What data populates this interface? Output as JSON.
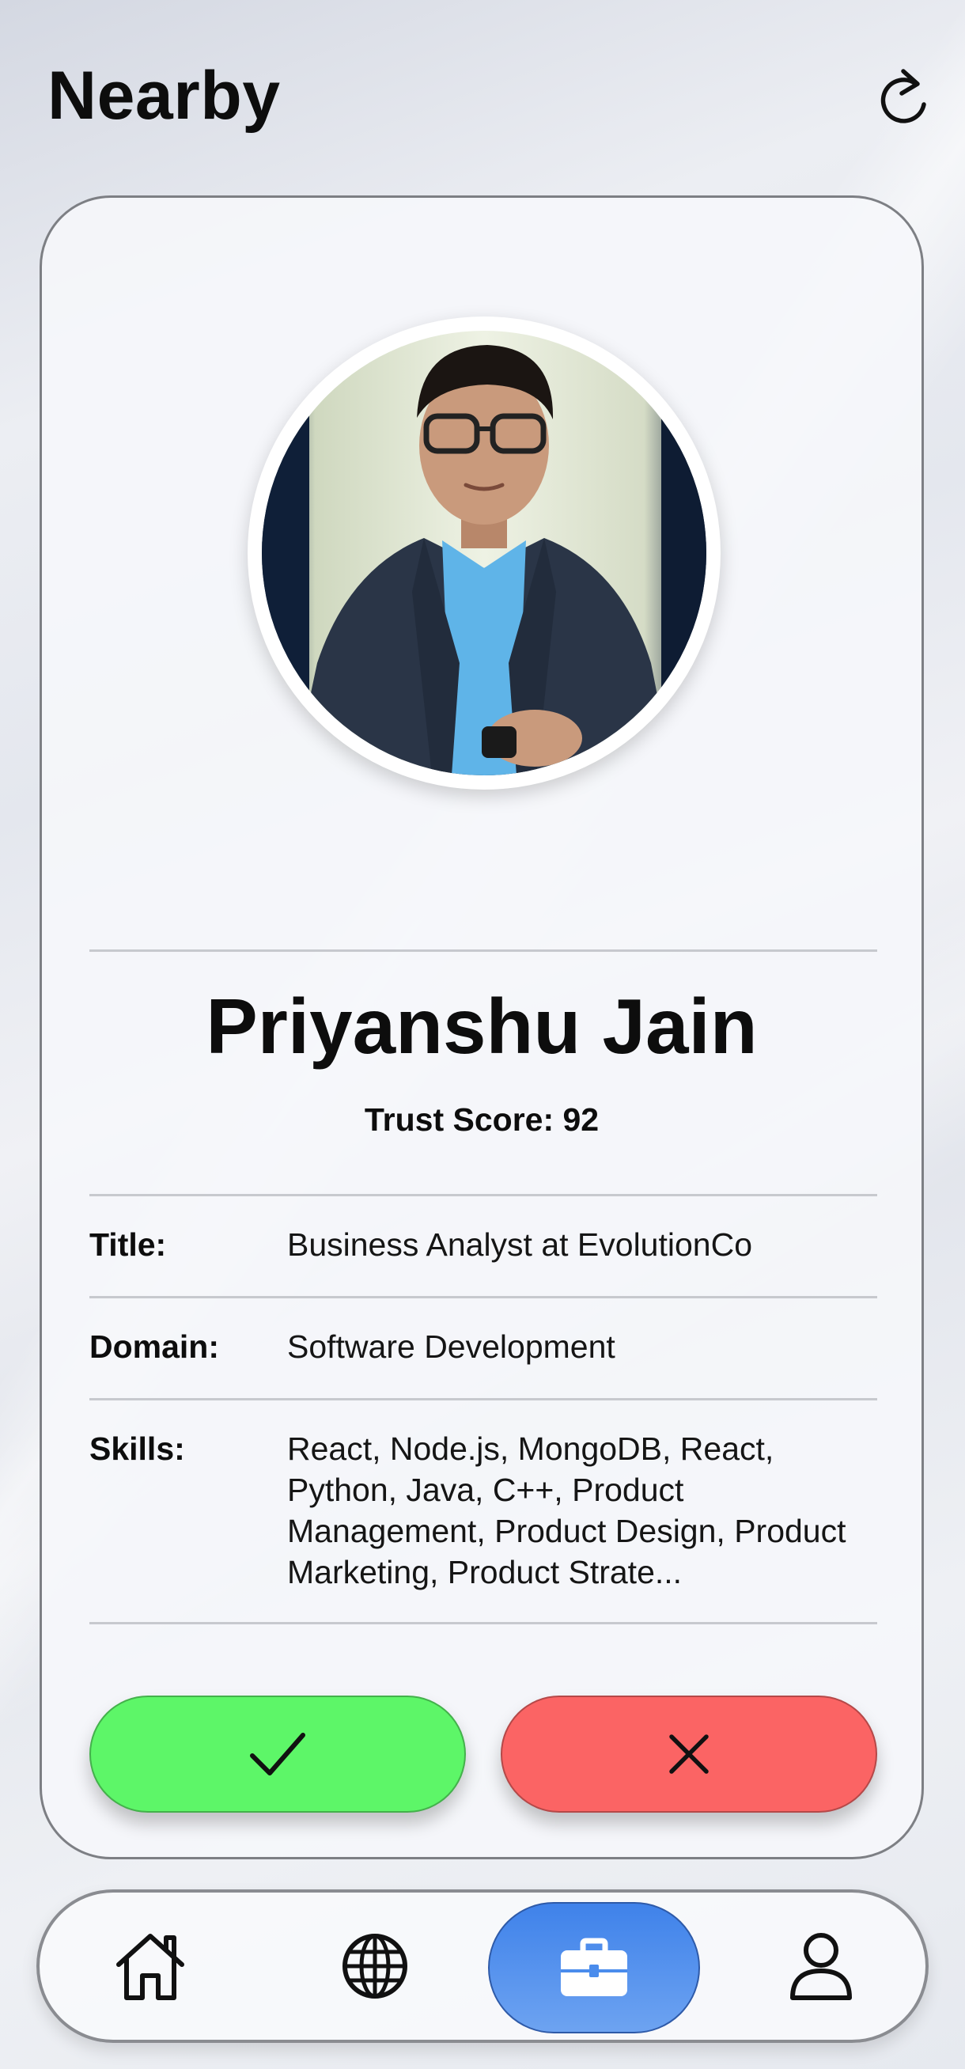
{
  "header": {
    "title": "Nearby",
    "refresh_icon": "refresh-icon"
  },
  "profile": {
    "name": "Priyanshu Jain",
    "trust_score_text": "Trust Score: 92",
    "fields": {
      "title": {
        "label": "Title:",
        "value": "Business Analyst at EvolutionCo"
      },
      "domain": {
        "label": "Domain:",
        "value": "Software Development"
      },
      "skills": {
        "label": "Skills:",
        "value": "React, Node.js, MongoDB, React, Python, Java, C++, Product Management, Product Design, Product Marketing, Product Strate..."
      }
    }
  },
  "actions": {
    "accept_icon": "checkmark-icon",
    "reject_icon": "close-icon"
  },
  "bottom_nav": {
    "items": [
      {
        "name": "home",
        "icon": "home-icon",
        "active": false
      },
      {
        "name": "explore",
        "icon": "globe-icon",
        "active": false
      },
      {
        "name": "jobs",
        "icon": "briefcase-icon",
        "active": true
      },
      {
        "name": "profile",
        "icon": "user-icon",
        "active": false
      }
    ]
  },
  "colors": {
    "accept": "#5df668",
    "reject": "#fb6464",
    "nav_active": "#4a8cec",
    "text": "#0d0d0d"
  }
}
